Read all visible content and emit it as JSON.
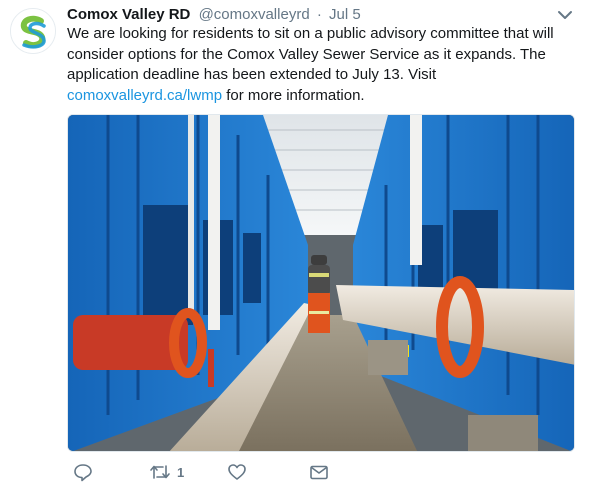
{
  "tweet": {
    "display_name": "Comox Valley RD",
    "handle": "@comoxvalleyrd",
    "separator": "·",
    "time": "Jul 5",
    "text_line1": "We are looking for residents to sit on a public advisory committee that will consider options for the Comox Valley Sewer Service as it expands. The application deadline has been extended to July 13. Visit ",
    "link_text": "comoxvalleyrd.ca/lwmp",
    "text_line2": " for more information."
  },
  "actions": {
    "reply_icon": "reply-icon",
    "retweet_icon": "retweet-icon",
    "retweet_count": "1",
    "like_icon": "heart-icon",
    "dm_icon": "envelope-icon"
  },
  "colors": {
    "text": "#14171a",
    "secondary": "#657786",
    "link": "#1b95e0",
    "avatar_green": "#7cc242",
    "avatar_blue": "#1f9bd7",
    "pipe_blue": "#1f6fbf",
    "flange_orange": "#e0541e",
    "valve_red": "#d23a2a"
  }
}
